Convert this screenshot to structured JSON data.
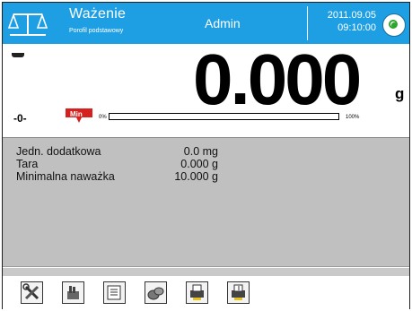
{
  "header": {
    "mode_title": "Ważenie",
    "profile": "Porofil podstawowy",
    "user": "Admin",
    "date": "2011.09.05",
    "time": "09:10:00"
  },
  "display": {
    "weight": "0.000",
    "unit": "g",
    "zero_label": "-0-",
    "min_label": "Min",
    "bar_min_label": "0%",
    "bar_max_label": "100%",
    "bar_fill_percent": 0
  },
  "info": {
    "rows": [
      {
        "label": "Jedn. dodatkowa",
        "value": "0.0 mg"
      },
      {
        "label": "Tara",
        "value": "0.000 g"
      },
      {
        "label": "Minimalna naważka",
        "value": "10.000 g"
      }
    ]
  },
  "toolbar": {
    "buttons": [
      {
        "icon": "tools-icon"
      },
      {
        "icon": "tare-hand-icon"
      },
      {
        "icon": "report-icon"
      },
      {
        "icon": "weights-icon"
      },
      {
        "icon": "print-header-icon"
      },
      {
        "icon": "print-footer-icon"
      }
    ]
  },
  "colors": {
    "header_bg": "#1e9fe4",
    "info_bg": "#c0c0c0",
    "min_badge": "#d6201f",
    "level_green": "#2ca52c"
  }
}
